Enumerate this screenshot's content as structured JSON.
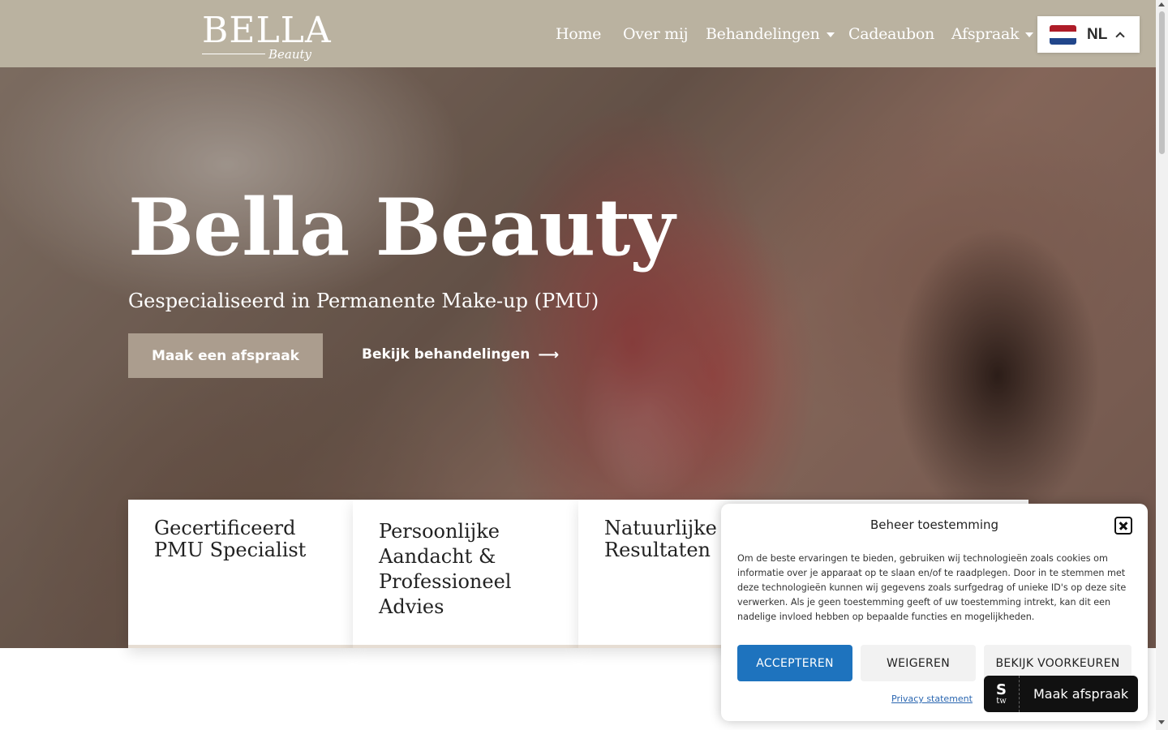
{
  "header": {
    "logo": {
      "main": "BELLA",
      "sub": "Beauty"
    },
    "nav": [
      {
        "label": "Home",
        "has_dropdown": false
      },
      {
        "label": "Over mij",
        "has_dropdown": false
      },
      {
        "label": "Behandelingen",
        "has_dropdown": true
      },
      {
        "label": "Cadeaubon",
        "has_dropdown": false
      },
      {
        "label": "Afspraak",
        "has_dropdown": true
      }
    ],
    "language": {
      "code": "NL",
      "flag_colors": [
        "#ae1c28",
        "#ffffff",
        "#21468b"
      ]
    }
  },
  "hero": {
    "title": "Bella Beauty",
    "subtitle": "Gespecialiseerd in Permanente Make-up (PMU)",
    "primary_button": "Maak een afspraak",
    "secondary_link": "Bekijk behandelingen",
    "secondary_arrow": "⟶"
  },
  "features": [
    {
      "title": "Gecertificeerd PMU Specialist"
    },
    {
      "title": "Persoonlijke Aandacht & Professioneel Advies"
    },
    {
      "title": "Natuurlijke Resultaten"
    }
  ],
  "cookie_dialog": {
    "title": "Beheer toestemming",
    "text": "Om de beste ervaringen te bieden, gebruiken wij technologieën zoals cookies om informatie over je apparaat op te slaan en/of te raadplegen. Door in te stemmen met deze technologieën kunnen wij gegevens zoals surfgedrag of unieke ID's op deze site verwerken. Als je geen toestemming geeft of uw toestemming intrekt, kan dit een nadelige invloed hebben op bepaalde functies en mogelijkheden.",
    "accept": "ACCEPTEREN",
    "deny": "WEIGEREN",
    "preferences": "BEKIJK VOORKEUREN",
    "privacy_link": "Privacy statement"
  },
  "booking_widget": {
    "label": "Maak afspraak",
    "icon_top": "S",
    "icon_bottom": "tw"
  },
  "colors": {
    "header_bg": "#bab2a0",
    "primary_button": "#ab9d8e",
    "accept_button": "#1e73be"
  }
}
